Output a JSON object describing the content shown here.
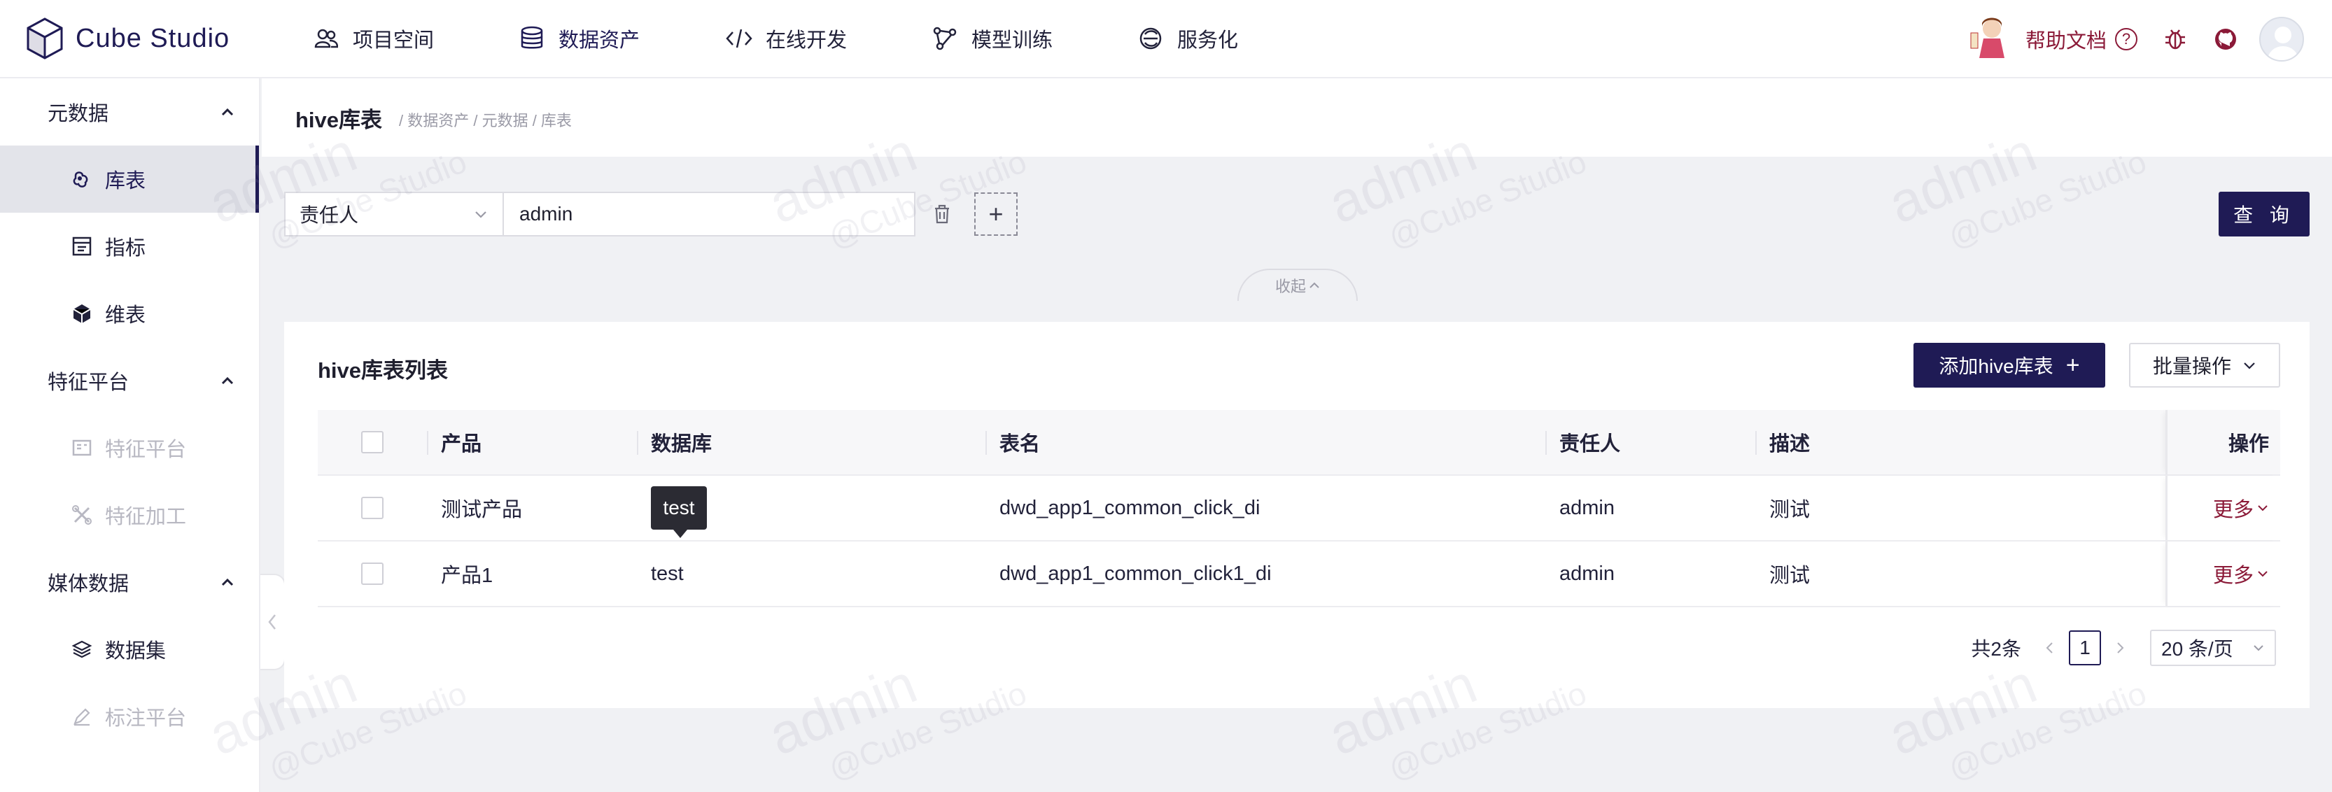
{
  "app": {
    "name": "Cube Studio"
  },
  "nav": {
    "items": [
      {
        "label": "项目空间",
        "icon": "team-icon"
      },
      {
        "label": "数据资产",
        "icon": "database-icon",
        "active": true
      },
      {
        "label": "在线开发",
        "icon": "code-icon"
      },
      {
        "label": "模型训练",
        "icon": "model-icon"
      },
      {
        "label": "服务化",
        "icon": "service-icon"
      }
    ],
    "help_label": "帮助文档"
  },
  "sidebar": {
    "groups": [
      {
        "label": "元数据",
        "items": [
          {
            "label": "库表",
            "icon": "table-icon",
            "active": true
          },
          {
            "label": "指标",
            "icon": "metric-icon"
          },
          {
            "label": "维表",
            "icon": "cube-icon"
          }
        ]
      },
      {
        "label": "特征平台",
        "items": [
          {
            "label": "特征平台",
            "icon": "feature-icon",
            "disabled": true
          },
          {
            "label": "特征加工",
            "icon": "tools-icon",
            "disabled": true
          }
        ]
      },
      {
        "label": "媒体数据",
        "items": [
          {
            "label": "数据集",
            "icon": "layers-icon"
          },
          {
            "label": "标注平台",
            "icon": "edit-icon",
            "disabled": true
          }
        ]
      }
    ]
  },
  "page": {
    "title": "hive库表",
    "breadcrumb": "/ 数据资产 / 元数据 / 库表"
  },
  "filter": {
    "field": "责任人",
    "value": "admin",
    "query_label": "查 询",
    "fold_label": "收起"
  },
  "table_card": {
    "title": "hive库表列表",
    "add_label": "添加hive库表",
    "batch_label": "批量操作",
    "columns": [
      "产品",
      "数据库",
      "表名",
      "责任人",
      "描述",
      "操作"
    ],
    "rows": [
      {
        "product": "测试产品",
        "database": "test",
        "table_name": "dwd_app1_common_click_di",
        "owner": "admin",
        "description": "测试",
        "action": "更多"
      },
      {
        "product": "产品1",
        "database": "test",
        "table_name": "dwd_app1_common_click1_di",
        "owner": "admin",
        "description": "测试",
        "action": "更多"
      }
    ],
    "tooltip": "test",
    "pagination": {
      "total": "共2条",
      "current": "1",
      "page_size": "20 条/页"
    }
  },
  "watermark": {
    "text": "admin",
    "sub": "@Cube Studio"
  },
  "colors": {
    "primary": "#1f1b55",
    "link": "#8b1a38",
    "background": "#f0f1f4"
  }
}
